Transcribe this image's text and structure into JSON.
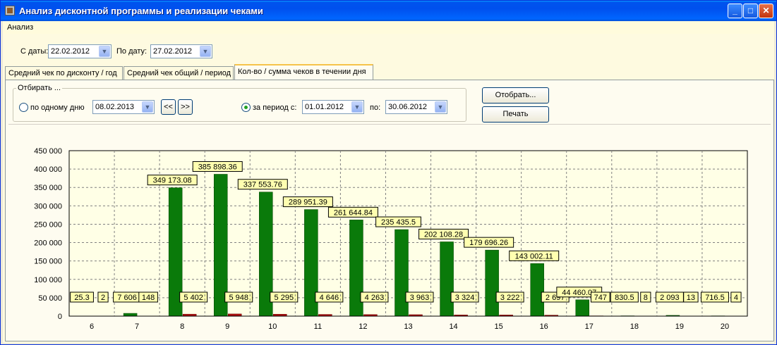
{
  "window": {
    "title": "Анализ дисконтной программы и реализации чеками",
    "controls": {
      "minimize": "_",
      "maximize": "□",
      "close": "✕"
    }
  },
  "menu": {
    "items": [
      "Анализ"
    ]
  },
  "filters": {
    "from_label": "С даты:",
    "from_value": "22.02.2012",
    "to_label": "По дату:",
    "to_value": "27.02.2012"
  },
  "tabs": [
    {
      "label": "Средний чек по дисконту / год"
    },
    {
      "label": "Средний чек общий / период"
    },
    {
      "label": "Кол-во / сумма чеков в течении дня",
      "active": true
    }
  ],
  "selection": {
    "group_title": "Отбирать ...",
    "one_day_label": "по одному дню",
    "one_day_value": "08.02.2013",
    "prev_label": "<<",
    "next_label": ">>",
    "period_label": "за период с:",
    "period_from": "01.01.2012",
    "period_to_label": "по:",
    "period_to": "30.06.2012",
    "selected": "period"
  },
  "buttons": {
    "select": "Отобрать...",
    "print": "Печать"
  },
  "colors": {
    "sum_bar": "#0a7a0a",
    "count_bar": "#b01010",
    "plot_bg": "#ffffe6",
    "label_bg": "#ffffb0"
  },
  "chart_data": {
    "type": "bar",
    "categories": [
      "6",
      "7",
      "8",
      "9",
      "10",
      "11",
      "12",
      "13",
      "14",
      "15",
      "16",
      "17",
      "18",
      "19",
      "20"
    ],
    "y_ticks": [
      "0",
      "50 000",
      "100 000",
      "150 000",
      "200 000",
      "250 000",
      "300 000",
      "350 000",
      "400 000",
      "450 000"
    ],
    "ylim": [
      0,
      450000
    ],
    "grid": true,
    "series": [
      {
        "values": [
          25.3,
          7606,
          349173.08,
          385898.36,
          337553.76,
          289951.39,
          261644.84,
          235435.5,
          202108.28,
          179696.26,
          143002.11,
          44460.07,
          830.5,
          2093,
          716.5
        ],
        "labels": [
          "25.3",
          "7 606",
          "349 173.08",
          "385 898.36",
          "337 553.76",
          "289 951.39",
          "261 644.84",
          "235 435.5",
          "202 108.28",
          "179 696.26",
          "143 002.11",
          "44 460.07",
          "830.5",
          "2 093",
          "716.5"
        ]
      },
      {
        "values": [
          2,
          148,
          5402,
          5948,
          5295,
          4646,
          4263,
          3963,
          3324,
          3222,
          2697,
          747,
          8,
          13,
          4
        ],
        "labels": [
          "2",
          "148",
          "5 402",
          "5 948",
          "5 295",
          "4 646",
          "4 263",
          "3 963",
          "3 324",
          "3 222",
          "2 697",
          "747",
          "8",
          "13",
          "4"
        ]
      }
    ]
  }
}
